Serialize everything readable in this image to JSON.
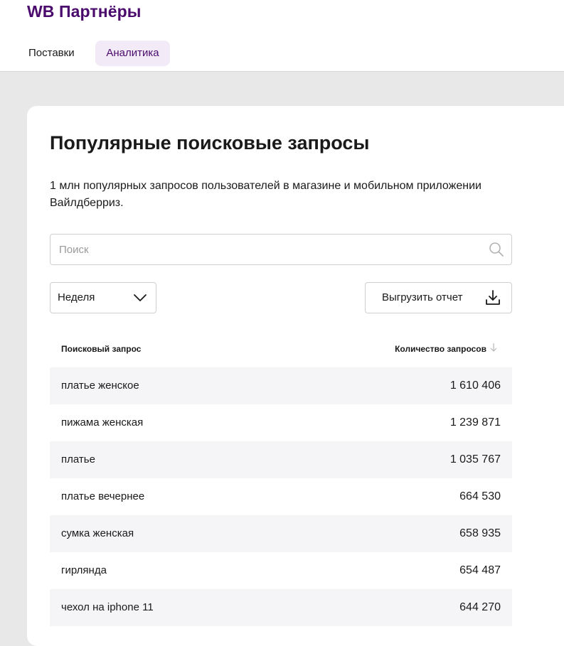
{
  "header": {
    "logo": "WB Партнёры",
    "tabs": [
      {
        "label": "Поставки",
        "active": false
      },
      {
        "label": "Аналитика",
        "active": true
      }
    ]
  },
  "main": {
    "title": "Популярные поисковые запросы",
    "description": "1 млн популярных запросов пользователей в магазине и мобильном приложении Вайлдберриз.",
    "search": {
      "placeholder": "Поиск",
      "value": "",
      "icon": "search-icon"
    },
    "period": {
      "selected": "Неделя",
      "icon": "chevron-down-icon"
    },
    "export": {
      "label": "Выгрузить отчет",
      "icon": "download-icon"
    },
    "table": {
      "columns": {
        "query": "Поисковый запрос",
        "count": "Количество запросов",
        "sort_icon": "arrow-down-icon"
      },
      "rows": [
        {
          "query": "платье женское",
          "count": "1 610 406"
        },
        {
          "query": "пижама женская",
          "count": "1 239 871"
        },
        {
          "query": "платье",
          "count": "1 035 767"
        },
        {
          "query": "платье вечернее",
          "count": "664 530"
        },
        {
          "query": "сумка женская",
          "count": "658 935"
        },
        {
          "query": "гирлянда",
          "count": "654 487"
        },
        {
          "query": "чехол на iphone 11",
          "count": "644 270"
        }
      ]
    }
  },
  "colors": {
    "brand": "#4b0b6d",
    "active_tab_bg": "#f2eaf6",
    "page_bg": "#e8e8e8",
    "row_stripe": "#f5f5f8"
  }
}
